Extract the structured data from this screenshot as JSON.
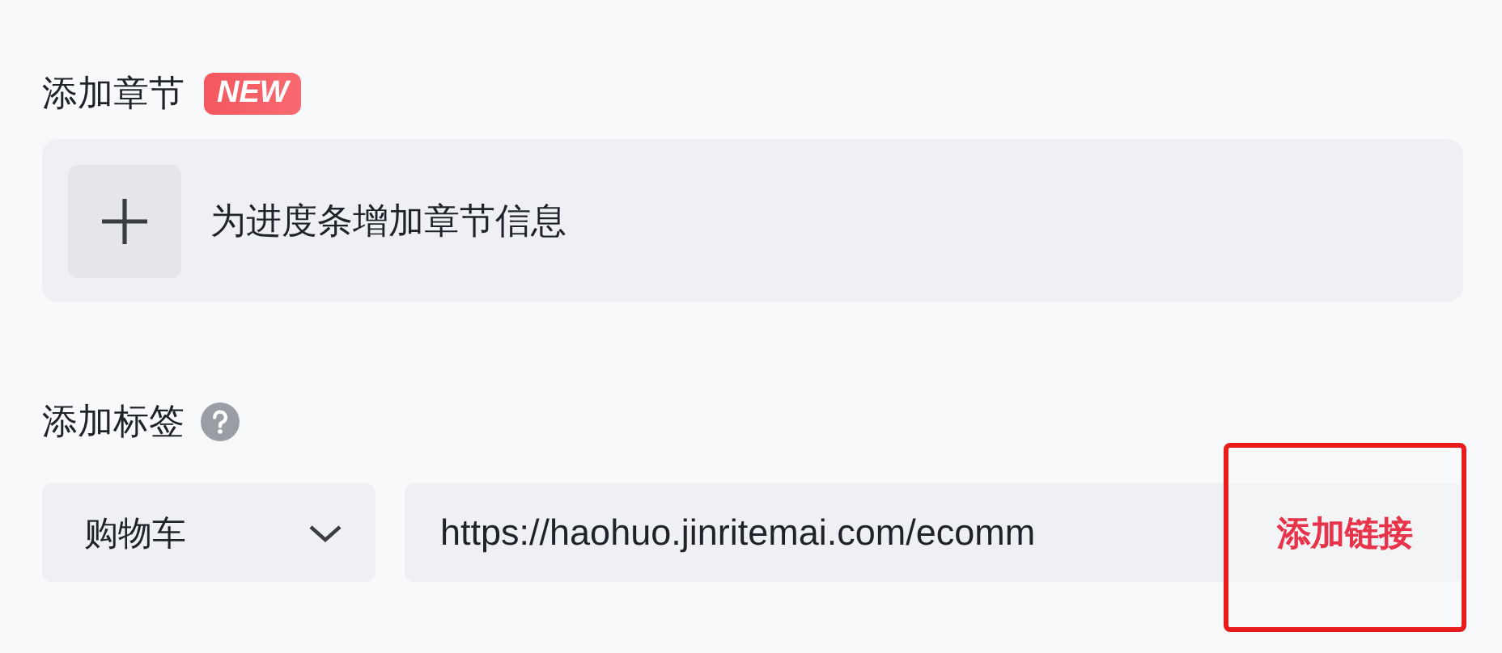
{
  "chapters": {
    "title": "添加章节",
    "badge": "NEW",
    "add_text": "为进度条增加章节信息"
  },
  "tags": {
    "title": "添加标签",
    "select": {
      "value": "购物车"
    },
    "link": {
      "value": "https://haohuo.jinritemai.com/ecomm",
      "action": "添加链接",
      "highlighted": true
    }
  }
}
